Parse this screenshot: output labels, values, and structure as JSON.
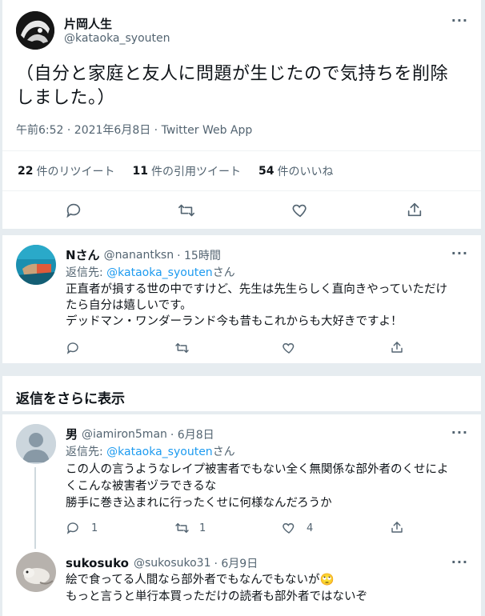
{
  "main_tweet": {
    "display_name": "片岡人生",
    "handle": "@kataoka_syouten",
    "text_line1": "（自分と家庭と友人に問題が生じたので気持ちを削除",
    "text_line2": "しました。）",
    "meta": "午前6:52 · 2021年6月8日 · Twitter Web App",
    "stats": {
      "retweets_count": "22",
      "retweets_label": "件のリツイート",
      "quotes_count": "11",
      "quotes_label": "件の引用ツイート",
      "likes_count": "54",
      "likes_label": "件のいいね"
    }
  },
  "reply1": {
    "display_name": "Nさん",
    "handle": "@nanantksn",
    "time": "· 15時間",
    "reply_to_prefix": "返信先: ",
    "reply_to_handle": "@kataoka_syouten",
    "reply_to_suffix": "さん",
    "lines": [
      "正直者が損する世の中ですけど、先生は先生らしく直向きやっていただけ",
      "たら自分は嬉しいです。",
      "デッドマン・ワンダーランド今も昔もこれからも大好きですよ！"
    ]
  },
  "show_more": "返信をさらに表示",
  "reply2": {
    "display_name": "男",
    "handle": "@iamiron5man",
    "time": "· 6月8日",
    "reply_to_prefix": "返信先: ",
    "reply_to_handle": "@kataoka_syouten",
    "reply_to_suffix": "さん",
    "lines": [
      "この人の言うようなレイプ被害者でもない全く無関係な部外者のくせによ",
      "くこんな被害者ヅラできるな",
      "勝手に巻き込まれに行ったくせに何様なんだろうか"
    ],
    "reply_count": "1",
    "retweet_count": "1",
    "like_count": "4"
  },
  "reply3": {
    "display_name": "sukosuko",
    "handle": "@sukosuko31",
    "time": "· 6月9日",
    "lines": [
      "絵で食ってる人間なら部外者でもなんでもないが",
      "もっと言うと単行本買っただけの読者も部外者ではないぞ"
    ],
    "emoji": "🙄"
  },
  "more_label": "···",
  "colors": {
    "accent": "#1d9bf0",
    "muted": "#536471",
    "background": "#e6ecf0"
  }
}
